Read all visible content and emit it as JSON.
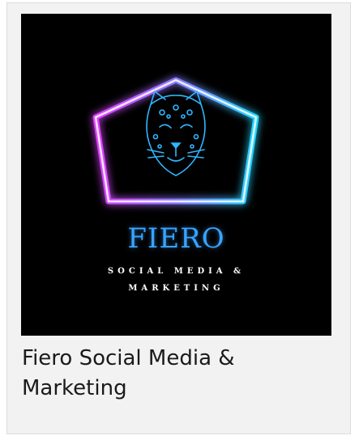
{
  "card": {
    "logo": {
      "icon": "jaguar-head-icon",
      "brand_name": "FIERO",
      "tagline_line1": "SOCIAL MEDIA &",
      "tagline_line2": "MARKETING",
      "colors": {
        "background": "#000000",
        "neon_pink": "#e040ff",
        "neon_cyan": "#22d8ff",
        "brand_blue": "#3aa3ff"
      }
    },
    "title": "Fiero Social Media & Marketing"
  }
}
